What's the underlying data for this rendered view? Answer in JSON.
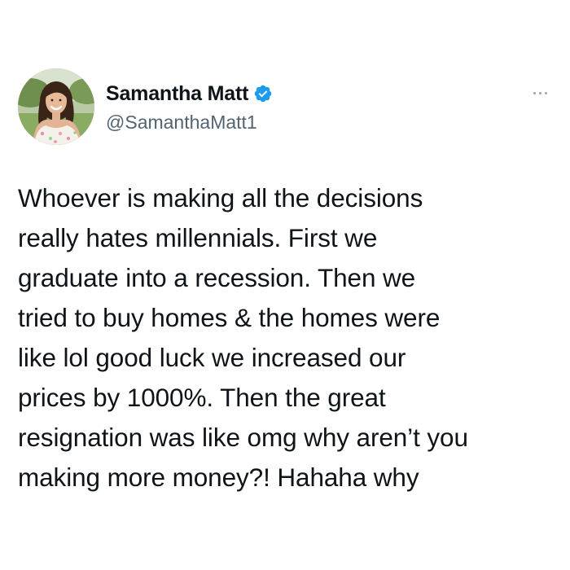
{
  "tweet": {
    "author": {
      "display_name": "Samantha Matt",
      "handle": "@SamanthaMatt1",
      "verified": true,
      "avatar_icon": "profile-photo",
      "verified_icon": "verified-badge-icon"
    },
    "more_icon": "more-options-icon",
    "text": "Whoever is making all the decisions\nreally hates millennials. First we\ngraduate into a recession. Then we\ntried to buy homes & the homes were\nlike lol good luck we increased our\nprices by 1000%. Then the great\nresignation was like omg why aren’t you\nmaking more money?! Hahaha why"
  },
  "colors": {
    "text": "#0f1419",
    "handle": "#536471",
    "verified": "#1d9bf0",
    "background": "#ffffff"
  }
}
